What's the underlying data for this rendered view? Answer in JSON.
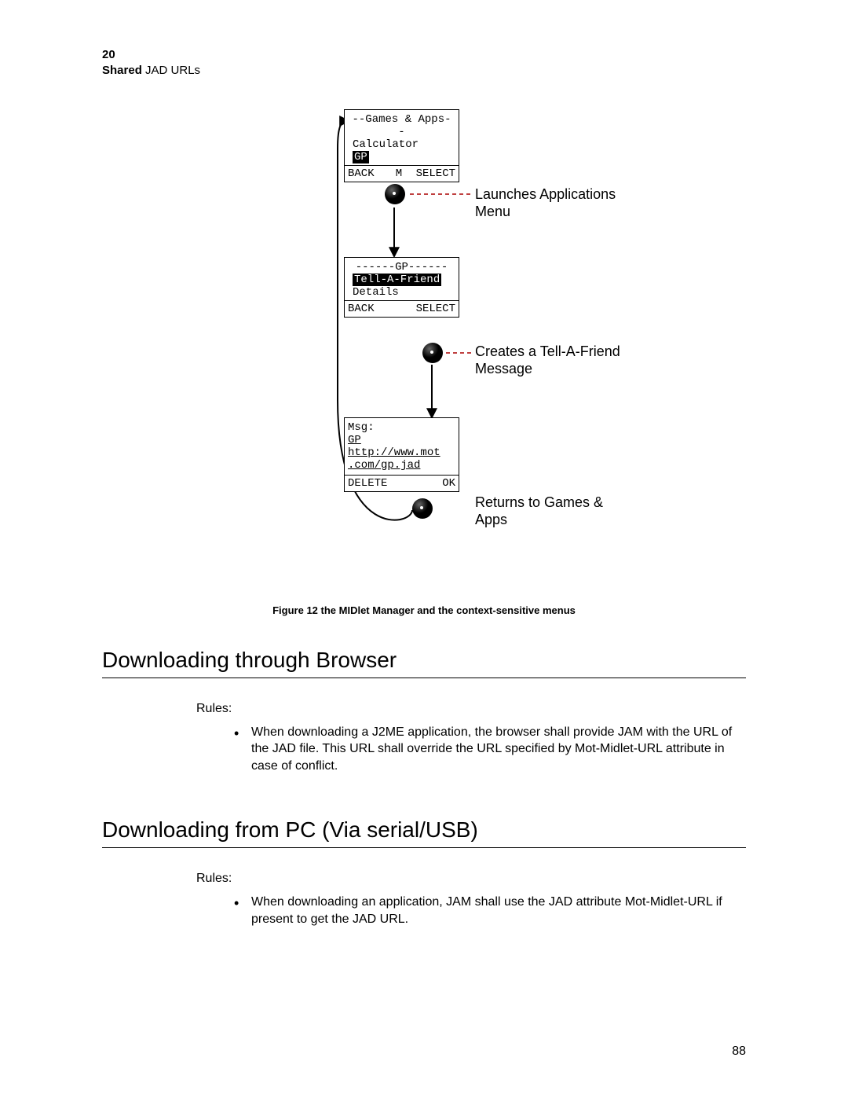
{
  "header": {
    "chapter_number": "20",
    "chapter_title_bold": "Shared",
    "chapter_title_rest": " JAD URLs"
  },
  "figure": {
    "screen1": {
      "title": "--Games & Apps--",
      "line2": "Calculator",
      "line3_hl": "GP",
      "sk_left": "BACK",
      "sk_mid": "M",
      "sk_right": "SELECT"
    },
    "annot1": "Launches Applications Menu",
    "screen2": {
      "title": "------GP------",
      "line2_hl": "Tell-A-Friend",
      "line3": "Details",
      "sk_left": "BACK",
      "sk_right": "SELECT"
    },
    "annot2": "Creates a Tell-A-Friend Message",
    "screen3": {
      "line1": "Msg:",
      "line2": "GP http://www.mot",
      "line3": ".com/gp.jad",
      "sk_left": "DELETE",
      "sk_right": "OK"
    },
    "annot3": "Returns to Games & Apps",
    "caption": "Figure 12 the MIDlet Manager and the context-sensitive menus"
  },
  "sections": {
    "browser": {
      "heading": "Downloading through Browser",
      "rules_label": "Rules:",
      "bullets": [
        "When downloading a J2ME application, the browser shall provide JAM with the URL of the JAD file. This URL shall override the URL specified by Mot-Midlet-URL attribute in case of conflict."
      ]
    },
    "pc": {
      "heading": "Downloading from PC (Via serial/USB)",
      "rules_label": "Rules:",
      "bullets": [
        "When downloading an application, JAM shall use the JAD attribute Mot-Midlet-URL if present to get the JAD URL."
      ]
    }
  },
  "page_number": "88"
}
